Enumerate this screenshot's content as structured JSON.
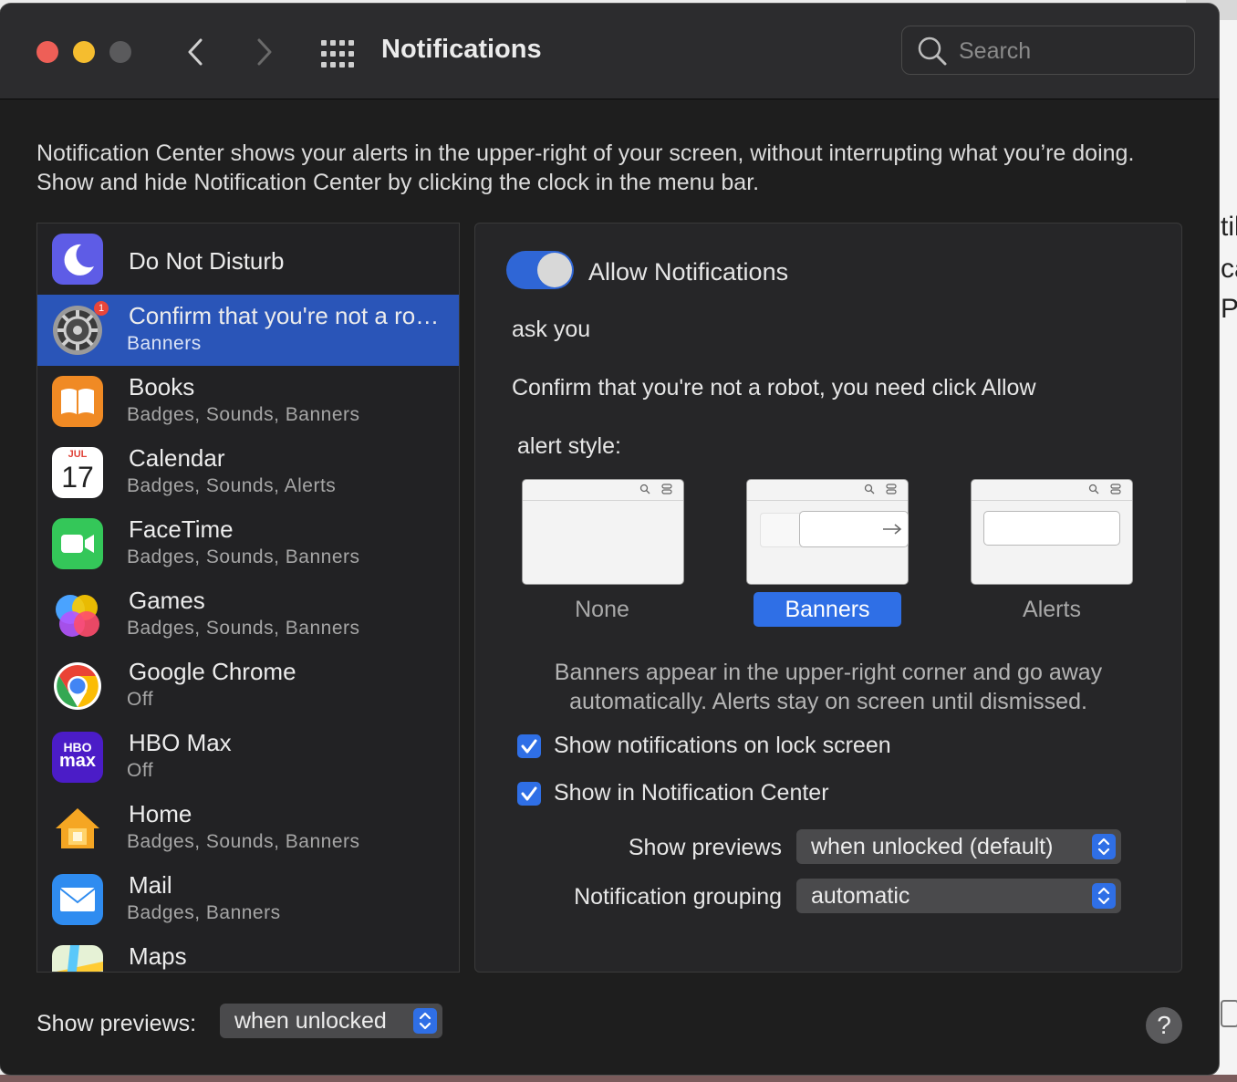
{
  "window": {
    "title": "Notifications"
  },
  "search": {
    "placeholder": "Search"
  },
  "description": "Notification Center shows your alerts in the upper-right of your screen, without interrupting what you’re doing. Show and hide Notification Center by clicking the clock in the menu bar.",
  "apps": [
    {
      "name": "Do Not Disturb",
      "sub": ""
    },
    {
      "name": "Confirm that you're not a robot, you need click Allow",
      "sub": "Banners",
      "selected": true,
      "badge": "1"
    },
    {
      "name": "Books",
      "sub": "Badges, Sounds, Banners"
    },
    {
      "name": "Calendar",
      "sub": "Badges, Sounds, Alerts",
      "cal_month": "JUL",
      "cal_day": "17"
    },
    {
      "name": "FaceTime",
      "sub": "Badges, Sounds, Banners"
    },
    {
      "name": "Games",
      "sub": "Badges, Sounds, Banners"
    },
    {
      "name": "Google Chrome",
      "sub": "Off"
    },
    {
      "name": "HBO Max",
      "sub": "Off",
      "logo_top": "HBO",
      "logo_bottom": "max"
    },
    {
      "name": "Home",
      "sub": "Badges, Sounds, Banners"
    },
    {
      "name": "Mail",
      "sub": "Badges, Banners"
    },
    {
      "name": "Maps",
      "sub": ""
    }
  ],
  "detail": {
    "allow_label": "Allow Notifications",
    "allow_on": true,
    "sender": "ask you",
    "message": "Confirm that you're not a robot, you need click Allow",
    "alert_style_label": "alert style:",
    "styles": [
      "None",
      "Banners",
      "Alerts"
    ],
    "selected_style": "Banners",
    "style_help": "Banners appear in the upper-right corner and go away automatically. Alerts stay on screen until dismissed.",
    "show_lock_screen": "Show notifications on lock screen",
    "show_in_center": "Show in Notification Center",
    "previews_label": "Show previews",
    "previews_value": "when unlocked (default)",
    "grouping_label": "Notification grouping",
    "grouping_value": "automatic"
  },
  "footer": {
    "previews_label": "Show previews:",
    "previews_value": "when unlocked",
    "help": "?"
  },
  "background_window": {
    "fragments": [
      "til",
      "ca",
      "P"
    ]
  },
  "colors": {
    "accent": "#2f6fe6",
    "selection": "#2a55b8",
    "close": "#ee5f57",
    "minimize": "#f5bd2f",
    "zoom_inactive": "#5a5a5c"
  }
}
